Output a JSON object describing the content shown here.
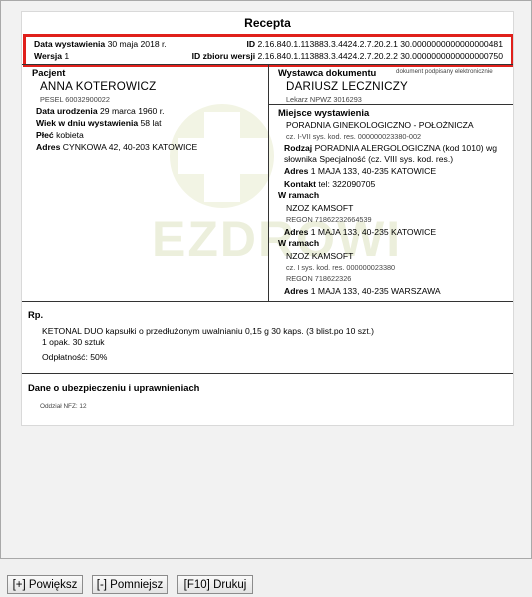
{
  "title": "Recepta",
  "header": {
    "date_label": "Data wystawienia",
    "date_value": "30 maja 2018 r.",
    "id_label": "ID",
    "id_value": "2.16.840.1.113883.3.4424.2.7.20.2.1 30.0000000000000000481",
    "version_label": "Wersja",
    "version_value": "1",
    "set_id_label": "ID zbioru wersji",
    "set_id_value": "2.16.840.1.113883.3.4424.2.7.20.2.2 30.0000000000000000750"
  },
  "patient": {
    "heading": "Pacjent",
    "name": "ANNA KOTEROWICZ",
    "pesel": "PESEL 60032900022",
    "birth_label": "Data urodzenia",
    "birth_value": "29 marca 1960 r.",
    "age_label": "Wiek w dniu wystawienia",
    "age_value": "58 lat",
    "sex_label": "Płeć",
    "sex_value": "kobieta",
    "address_label": "Adres",
    "address_value": "CYNKOWA 42, 40-203 KATOWICE"
  },
  "issuer": {
    "heading": "Wystawca dokumentu",
    "signed_note": "dokument podpisany elektronicznie",
    "name": "DARIUSZ LECZNICZY",
    "license": "Lekarz NPWZ 3016293",
    "place_heading": "Miejsce wystawienia",
    "place_name": "PORADNIA GINEKOLOGICZNO - POŁOŻNICZA",
    "place_code": "cz. I-VII sys. kod. res. 000000023380-002",
    "type_label": "Rodzaj",
    "type_value_1": "PORADNIA ALERGOLOGICZNA (kod 1010) wg",
    "type_value_2": "słownika Specjalność (cz. VIII sys. kod. res.)",
    "addr_label": "Adres",
    "addr_value": "1 MAJA 133, 40-235 KATOWICE",
    "contact_label": "Kontakt",
    "contact_value": "tel: 322090705",
    "within1_heading": "W ramach",
    "within1_name": "NZOZ KAMSOFT",
    "within1_regon": "REGON 71862232664539",
    "within1_addr_label": "Adres",
    "within1_addr_value": "1 MAJA 133, 40-235 KATOWICE",
    "within2_heading": "W ramach",
    "within2_name": "NZOZ KAMSOFT",
    "within2_code": "cz. I sys. kod. res. 000000023380",
    "within2_regon": "REGON 718622326",
    "within2_addr_label": "Adres",
    "within2_addr_value": "1 MAJA 133, 40-235 WARSZAWA"
  },
  "rp": {
    "heading": "Rp.",
    "drug": "KETONAL DUO kapsułki o przedłużonym uwalnianiu 0,15 g 30 kaps. (3 blist.po 10 szt.)",
    "quantity": "1 opak. 30 sztuk",
    "payment": "Odpłatność: 50%"
  },
  "insurance": {
    "heading": "Dane o ubezpieczeniu i uprawnieniach",
    "branch": "Oddział NFZ: 12"
  },
  "watermark_text": "EZDROWIE",
  "buttons": {
    "zoom_in": "[+] Powiększ",
    "zoom_out": "[-] Pomniejsz",
    "print": "[F10] Drukuj"
  }
}
